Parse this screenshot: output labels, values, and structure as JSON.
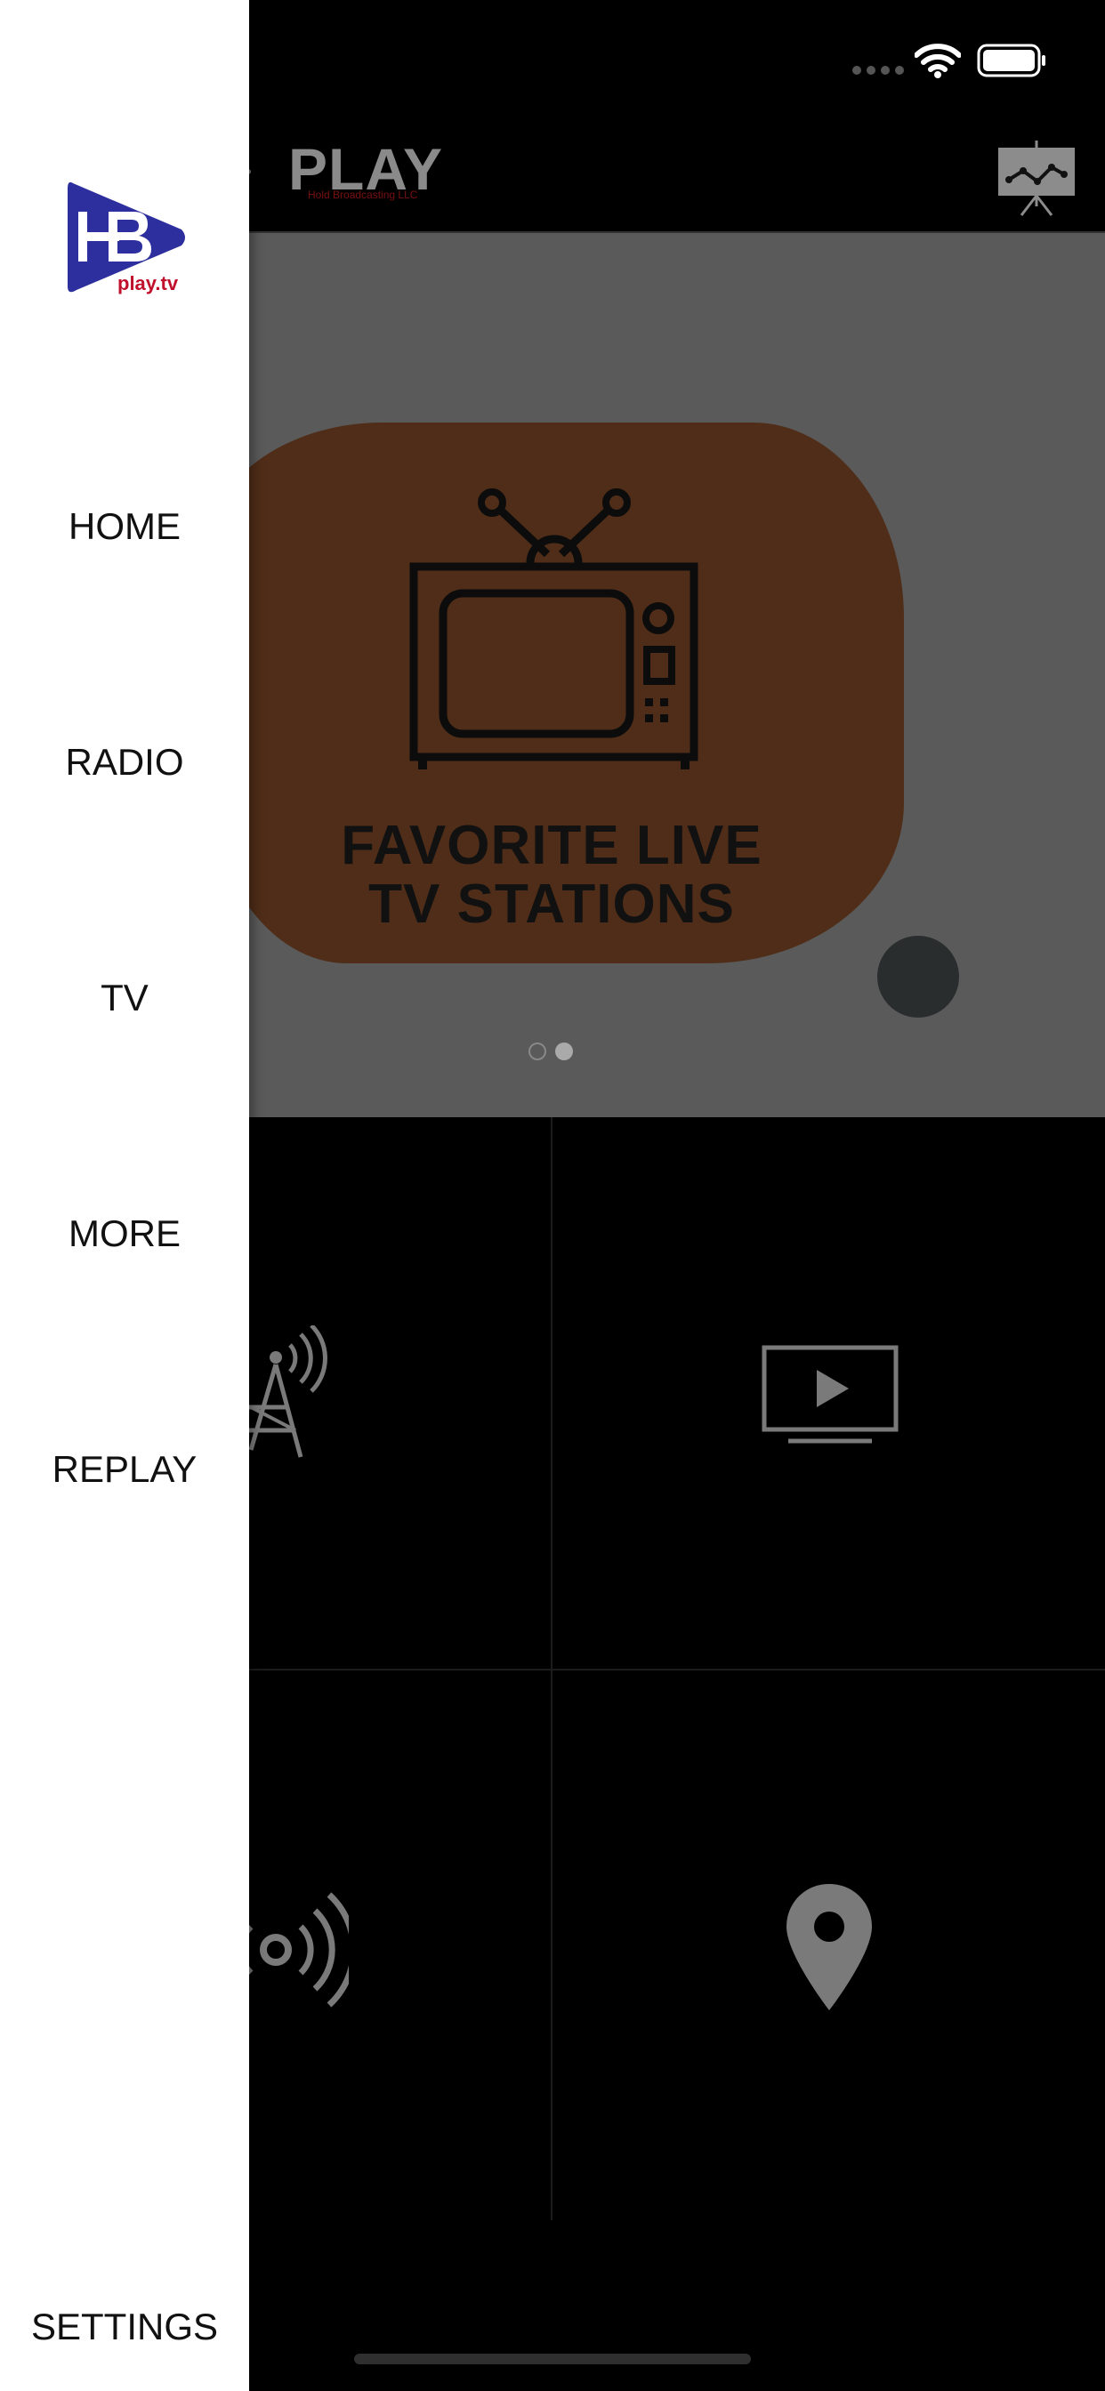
{
  "header": {
    "title": "PLAY",
    "subtitle": "Hold Broadcasting LLC"
  },
  "banner": {
    "card_title_line1": "FAVORITE LIVE",
    "card_title_line2": "TV STATIONS",
    "pager": {
      "total": 2,
      "active": 2
    }
  },
  "drawer": {
    "logo_text": "play.tv",
    "items": [
      {
        "label": "HOME"
      },
      {
        "label": "RADIO"
      },
      {
        "label": "TV"
      },
      {
        "label": "MORE"
      },
      {
        "label": "REPLAY"
      },
      {
        "label": "SETTINGS"
      }
    ]
  },
  "icons": {
    "status": [
      "signal-dots-icon",
      "wifi-icon",
      "battery-icon"
    ],
    "header": [
      "chart-presentation-icon"
    ],
    "grid": [
      "radio-tower-icon",
      "video-play-icon",
      "broadcast-icon",
      "location-pin-icon"
    ]
  },
  "colors": {
    "drawer_bg": "#ffffff",
    "card_bg": "#4f2d18",
    "banner_bg": "#5a5a5a",
    "logo_blue": "#2e2f9e",
    "logo_red": "#c0102b"
  }
}
